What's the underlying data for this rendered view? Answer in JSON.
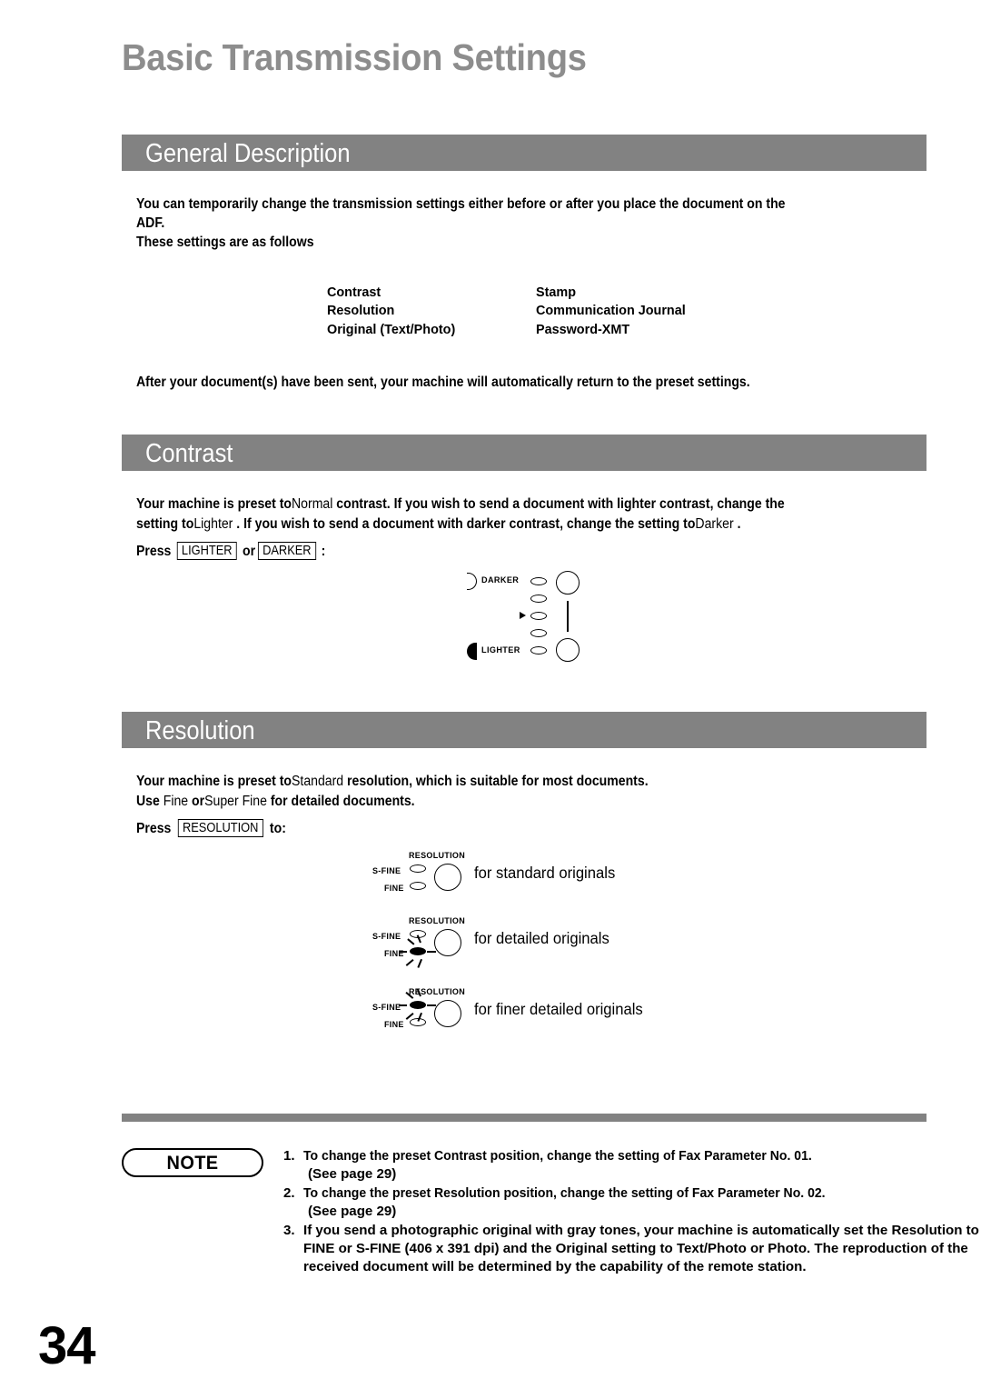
{
  "page": {
    "title": "Basic Transmission Settings",
    "number": "34",
    "title_color": "#8d8d8d",
    "band_color": "#828282"
  },
  "sections": [
    {
      "id": "general-description",
      "heading": "General Description",
      "intro_line1": "You can temporarily change the transmission settings either before or after you place the document on the",
      "intro_line2": "ADF.",
      "intro_line3": "These settings are as follows",
      "settings": [
        {
          "col1": "Contrast",
          "col2": "Stamp"
        },
        {
          "col1": "Resolution",
          "col2": "Communication Journal"
        },
        {
          "col1": "Original (Text/Photo)",
          "col2": "Password-XMT"
        }
      ],
      "closing": "After your document(s) have been sent, your machine will automatically return to the preset settings."
    },
    {
      "id": "contrast",
      "heading": "Contrast",
      "line1_a": "Your machine is preset to",
      "line1_b": "Normal",
      "line1_c": "contrast. If you wish to send a document with lighter contrast, change the",
      "line2_a": "setting to",
      "line2_b": "Lighter",
      "line2_c": ". If you wish to send a document with darker contrast, change the setting to",
      "line2_d": "Darker",
      "line2_e": ".",
      "press_label": "Press",
      "key_lighter": "LIGHTER",
      "or_label": "or",
      "key_darker": "DARKER",
      "colon": ":",
      "panel": {
        "darker_label": "DARKER",
        "lighter_label": "LIGHTER",
        "led_count": 5,
        "active_led_index": 2
      }
    },
    {
      "id": "resolution",
      "heading": "Resolution",
      "line1_a": "Your machine is preset to",
      "line1_b": "Standard",
      "line1_c": "resolution, which is suitable for most documents.",
      "line2_a": "Use",
      "line2_b": "Fine",
      "line2_c": "or",
      "line2_d": "Super Fine",
      "line2_e": "for detailed documents.",
      "press_label": "Press",
      "key_resolution": "RESOLUTION",
      "to_label": "to:",
      "panels": [
        {
          "resolution_label": "RESOLUTION",
          "sfine_label": "S-FINE",
          "fine_label": "FINE",
          "lit": "none",
          "caption": "for standard originals"
        },
        {
          "resolution_label": "RESOLUTION",
          "sfine_label": "S-FINE",
          "fine_label": "FINE",
          "lit": "fine",
          "caption": "for detailed originals"
        },
        {
          "resolution_label": "RESOLUTION",
          "sfine_label": "S-FINE",
          "fine_label": "FINE",
          "lit": "sfine",
          "caption": "for finer detailed originals"
        }
      ]
    }
  ],
  "note": {
    "badge": "NOTE",
    "items": [
      {
        "num": "1.",
        "text": "To change the preset Contrast position, change the setting of Fax Parameter No. 01.",
        "sub": "(See page 29)"
      },
      {
        "num": "2.",
        "text": "To change the preset Resolution position, change the setting of Fax Parameter No. 02.",
        "sub": "(See page 29)"
      },
      {
        "num": "3.",
        "text": "If you send a photographic original with gray tones, your machine is automatically set the Resolution to FINE or S-FINE (406 x 391 dpi) and the Original setting to Text/Photo or Photo. The reproduction of the received document will be determined by the capability of the remote station.",
        "sub": ""
      }
    ]
  }
}
